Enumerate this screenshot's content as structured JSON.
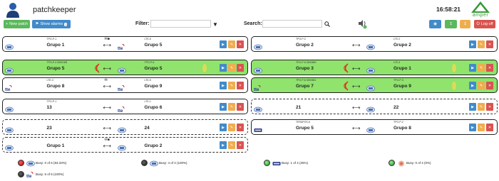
{
  "header": {
    "app_name": "patchkeeper",
    "clock": "16:58:21",
    "brand": "amper"
  },
  "toolbar": {
    "new_patch_label": "New patch",
    "show_alarms_label": "Show alarms",
    "alarm_count": "1",
    "filter_label": "Filter:",
    "filter_value": "",
    "search_label": "Search:",
    "search_value": "",
    "logoff_label": "Log off"
  },
  "patches": [
    {
      "a_small": "TPG-P-1",
      "a_icon": "radio",
      "a_name": "Grupo 1",
      "b_small": "LTE-6",
      "b_icon": "tte",
      "b_name": "Grupo 5",
      "busy": false,
      "dashed": false,
      "status": "mail-square",
      "ring": false
    },
    {
      "a_small": "TPG-P-2",
      "a_icon": "radio",
      "a_name": "Grupo 2",
      "b_small": "LTE-2",
      "b_icon": "radio",
      "b_name": "Grupo 2",
      "busy": false,
      "dashed": false,
      "status": "",
      "ring": false
    },
    {
      "a_small": "TPG-P-4 3000168",
      "a_icon": "radio",
      "a_name": "Grupo 5",
      "b_small": "TPG-P-5",
      "b_icon": "radio",
      "b_name": "Grupo 5",
      "busy": true,
      "dashed": false,
      "status": "",
      "ring": true
    },
    {
      "a_small": "TPG-P-6 3000569",
      "a_icon": "radio",
      "a_name": "Grupo 3",
      "b_small": "LTE-4",
      "b_icon": "radio",
      "b_name": "Grupo 1",
      "busy": true,
      "dashed": false,
      "status": "",
      "ring": true
    },
    {
      "a_small": "LTE-3",
      "a_icon": "tte",
      "a_name": "Grupo 8",
      "b_small": "LTE-5",
      "b_icon": "tte",
      "b_name": "Grupo 9",
      "busy": false,
      "dashed": false,
      "status": "mail",
      "ring": false
    },
    {
      "a_small": "TPG-P-8 3000561",
      "a_icon": "tte",
      "a_name": "Grupo 7",
      "b_small": "TPG-P-3",
      "b_icon": "radio",
      "b_name": "Grupo 9",
      "busy": true,
      "dashed": false,
      "status": "",
      "ring": true
    },
    {
      "a_small": "TPG-P-1",
      "a_icon": "radio",
      "a_name": "13",
      "b_small": "LTE-1",
      "b_icon": "tte",
      "b_name": "Grupo 6",
      "busy": false,
      "dashed": false,
      "status": "",
      "ring": false
    },
    {
      "a_small": "",
      "a_icon": "radio",
      "a_name": "21",
      "b_small": "",
      "b_icon": "radio",
      "b_name": "22",
      "busy": false,
      "dashed": true,
      "status": "",
      "ring": false
    },
    {
      "a_small": "",
      "a_icon": "radio",
      "a_name": "23",
      "b_small": "",
      "b_icon": "radio",
      "b_name": "24",
      "busy": false,
      "dashed": true,
      "status": "",
      "ring": false
    },
    {
      "a_small": "TERAPOS-6",
      "a_icon": "tetra",
      "a_name": "Grupo 5",
      "b_small": "TPG-P-2",
      "b_icon": "radio",
      "b_name": "Grupo 8",
      "busy": false,
      "dashed": false,
      "status": "",
      "ring": false
    },
    {
      "a_small": "",
      "a_icon": "radio",
      "a_name": "Grupo 1",
      "b_small": "",
      "b_icon": "radio",
      "b_name": "Grupo 2",
      "busy": false,
      "dashed": true,
      "status": "mail-square",
      "ring": false
    }
  ],
  "legend": [
    {
      "led": "red",
      "icon": "radio",
      "text": "Busy: 0 of 6 (83.33%)"
    },
    {
      "led": "black",
      "icon": "radio",
      "text": "Busy: 4 of 4 (100%)"
    },
    {
      "led": "green",
      "icon": "tetra",
      "text": "Busy: 1 of 4 (25%)"
    },
    {
      "led": "green",
      "icon": "sphere",
      "text": "Busy: 0 of 4 (0%)"
    },
    {
      "led": "black",
      "icon": "tte",
      "text": "Busy: 6 of 6 (100%)"
    }
  ],
  "colors": {
    "busy": "#90e36d",
    "primary": "#428bca",
    "warning": "#f0ad4e",
    "danger": "#d9534f",
    "success": "#5cb85c"
  }
}
